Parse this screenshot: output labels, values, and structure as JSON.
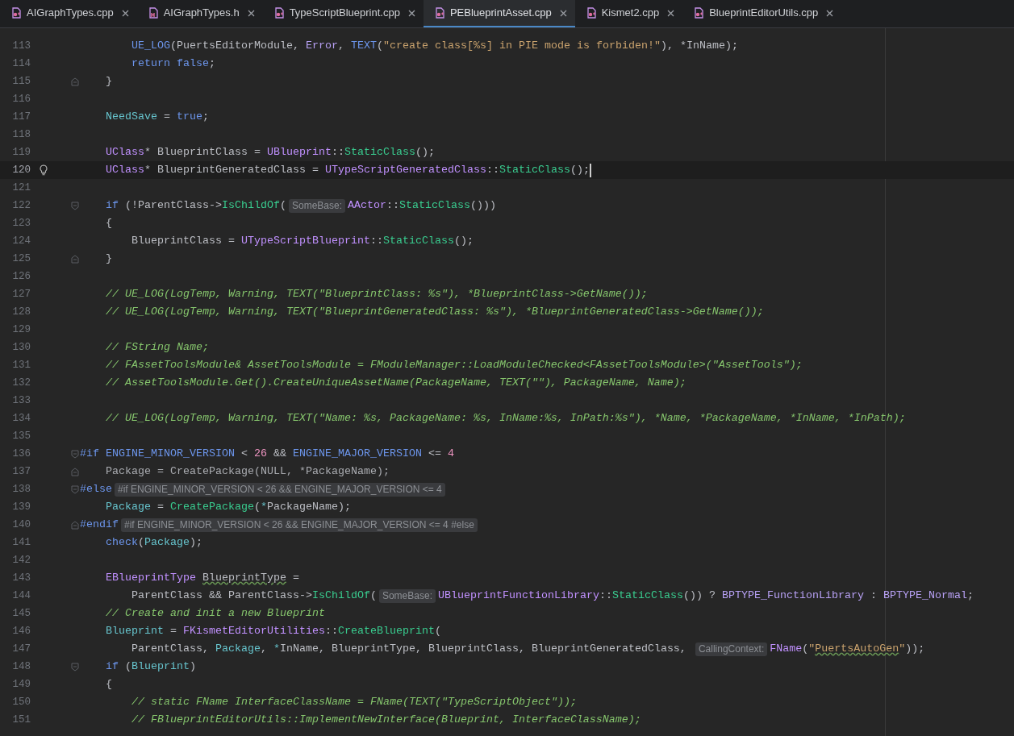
{
  "tabs": [
    {
      "label": "AIGraphTypes.cpp",
      "kind": "cpp",
      "selected": false
    },
    {
      "label": "AIGraphTypes.h",
      "kind": "h",
      "selected": false
    },
    {
      "label": "TypeScriptBlueprint.cpp",
      "kind": "cpp",
      "selected": false
    },
    {
      "label": "PEBlueprintAsset.cpp",
      "kind": "cpp",
      "selected": true
    },
    {
      "label": "Kismet2.cpp",
      "kind": "cpp",
      "selected": false
    },
    {
      "label": "BlueprintEditorUtils.cpp",
      "kind": "cpp",
      "selected": false
    }
  ],
  "lines": [
    {
      "n": "113",
      "tokens": [
        {
          "kind": "macro",
          "text": "        UE_LOG"
        },
        {
          "kind": "plain",
          "text": "(PuertsEditorModule, "
        },
        {
          "kind": "enum",
          "text": "Error"
        },
        {
          "kind": "plain",
          "text": ", "
        },
        {
          "kind": "macro",
          "text": "TEXT"
        },
        {
          "kind": "plain",
          "text": "("
        },
        {
          "kind": "string",
          "text": "\"create class[%s] in PIE mode is forbiden!\""
        },
        {
          "kind": "plain",
          "text": "), *InName);"
        }
      ]
    },
    {
      "n": "114",
      "tokens": [
        {
          "kind": "keyword",
          "text": "        return false"
        },
        {
          "kind": "plain",
          "text": ";"
        }
      ]
    },
    {
      "n": "115",
      "fold_end": true,
      "tokens": [
        {
          "kind": "plain",
          "text": "    }"
        }
      ]
    },
    {
      "n": "116"
    },
    {
      "n": "117",
      "tokens": [
        {
          "kind": "variable",
          "text": "    NeedSave"
        },
        {
          "kind": "plain",
          "text": " = "
        },
        {
          "kind": "keyword",
          "text": "true"
        },
        {
          "kind": "plain",
          "text": ";"
        }
      ]
    },
    {
      "n": "118"
    },
    {
      "n": "119",
      "tokens": [
        {
          "kind": "type",
          "text": "    UClass"
        },
        {
          "kind": "plain",
          "text": "* BlueprintClass = "
        },
        {
          "kind": "type",
          "text": "UBlueprint"
        },
        {
          "kind": "plain",
          "text": "::"
        },
        {
          "kind": "function",
          "text": "StaticClass"
        },
        {
          "kind": "plain",
          "text": "();"
        }
      ]
    },
    {
      "n": "120",
      "current": true,
      "bulb": true,
      "tokens": [
        {
          "kind": "type",
          "text": "    UClass"
        },
        {
          "kind": "plain",
          "text": "* BlueprintGeneratedClass = "
        },
        {
          "kind": "type",
          "text": "UTypeScriptGeneratedClass"
        },
        {
          "kind": "plain",
          "text": "::"
        },
        {
          "kind": "function",
          "text": "StaticClass"
        },
        {
          "kind": "plain",
          "text": "();"
        }
      ]
    },
    {
      "n": "121"
    },
    {
      "n": "122",
      "fold_start": true,
      "tokens": [
        {
          "kind": "keyword",
          "text": "    if"
        },
        {
          "kind": "plain",
          "text": " (!ParentClass->"
        },
        {
          "kind": "function",
          "text": "IsChildOf"
        },
        {
          "kind": "plain",
          "text": "("
        },
        {
          "kind": "hint",
          "text": "SomeBase:"
        },
        {
          "kind": "type",
          "text": "AActor"
        },
        {
          "kind": "plain",
          "text": "::"
        },
        {
          "kind": "function",
          "text": "StaticClass"
        },
        {
          "kind": "plain",
          "text": "()))"
        }
      ]
    },
    {
      "n": "123",
      "tokens": [
        {
          "kind": "plain",
          "text": "    {"
        }
      ]
    },
    {
      "n": "124",
      "tokens": [
        {
          "kind": "plain",
          "text": "        BlueprintClass = "
        },
        {
          "kind": "type",
          "text": "UTypeScriptBlueprint"
        },
        {
          "kind": "plain",
          "text": "::"
        },
        {
          "kind": "function",
          "text": "StaticClass"
        },
        {
          "kind": "plain",
          "text": "();"
        }
      ]
    },
    {
      "n": "125",
      "fold_end": true,
      "tokens": [
        {
          "kind": "plain",
          "text": "    }"
        }
      ]
    },
    {
      "n": "126"
    },
    {
      "n": "127",
      "tokens": [
        {
          "kind": "comment",
          "text": "    // UE_LOG(LogTemp, Warning, TEXT(\"BlueprintClass: %s\"), *BlueprintClass->GetName());"
        }
      ]
    },
    {
      "n": "128",
      "tokens": [
        {
          "kind": "comment",
          "text": "    // UE_LOG(LogTemp, Warning, TEXT(\"BlueprintGeneratedClass: %s\"), *BlueprintGeneratedClass->GetName());"
        }
      ]
    },
    {
      "n": "129"
    },
    {
      "n": "130",
      "tokens": [
        {
          "kind": "comment",
          "text": "    // FString Name;"
        }
      ]
    },
    {
      "n": "131",
      "tokens": [
        {
          "kind": "comment",
          "text": "    // FAssetToolsModule& AssetToolsModule = FModuleManager::LoadModuleChecked<FAssetToolsModule>(\"AssetTools\");"
        }
      ]
    },
    {
      "n": "132",
      "tokens": [
        {
          "kind": "comment",
          "text": "    // AssetToolsModule.Get().CreateUniqueAssetName(PackageName, TEXT(\"\"), PackageName, Name);"
        }
      ]
    },
    {
      "n": "133"
    },
    {
      "n": "134",
      "tokens": [
        {
          "kind": "comment",
          "text": "    // UE_LOG(LogTemp, Warning, TEXT(\"Name: %s, PackageName: %s, InName:%s, InPath:%s\"), *Name, *PackageName, *InName, *InPath);"
        }
      ]
    },
    {
      "n": "135"
    },
    {
      "n": "136",
      "fold_start": true,
      "tokens": [
        {
          "kind": "directive",
          "text": "#if "
        },
        {
          "kind": "macro",
          "text": "ENGINE_MINOR_VERSION"
        },
        {
          "kind": "plain",
          "text": " < "
        },
        {
          "kind": "number",
          "text": "26"
        },
        {
          "kind": "plain",
          "text": " && "
        },
        {
          "kind": "macro",
          "text": "ENGINE_MAJOR_VERSION"
        },
        {
          "kind": "plain",
          "text": " <= "
        },
        {
          "kind": "number",
          "text": "4"
        }
      ]
    },
    {
      "n": "137",
      "fold_end": true,
      "tokens": [
        {
          "kind": "inactive",
          "text": "    Package = CreatePackage(NULL, *PackageName);"
        }
      ]
    },
    {
      "n": "138",
      "fold_start": true,
      "tokens": [
        {
          "kind": "directive",
          "text": "#else"
        },
        {
          "kind": "hint",
          "text": "#if ENGINE_MINOR_VERSION < 26 && ENGINE_MAJOR_VERSION <= 4"
        }
      ]
    },
    {
      "n": "139",
      "tokens": [
        {
          "kind": "variable",
          "text": "    Package"
        },
        {
          "kind": "plain",
          "text": " = "
        },
        {
          "kind": "function",
          "text": "CreatePackage"
        },
        {
          "kind": "plain",
          "text": "("
        },
        {
          "kind": "variable",
          "text": "*"
        },
        {
          "kind": "plain",
          "text": "PackageName);"
        }
      ]
    },
    {
      "n": "140",
      "fold_end": true,
      "tokens": [
        {
          "kind": "directive",
          "text": "#endif"
        },
        {
          "kind": "hint",
          "text": "#if ENGINE_MINOR_VERSION < 26 && ENGINE_MAJOR_VERSION <= 4 #else"
        }
      ]
    },
    {
      "n": "141",
      "tokens": [
        {
          "kind": "macro",
          "text": "    check"
        },
        {
          "kind": "plain",
          "text": "("
        },
        {
          "kind": "variable",
          "text": "Package"
        },
        {
          "kind": "plain",
          "text": ");"
        }
      ]
    },
    {
      "n": "142"
    },
    {
      "n": "143",
      "tokens": [
        {
          "kind": "type",
          "text": "    EBlueprintType "
        },
        {
          "kind": "typo",
          "text": "BlueprintType"
        },
        {
          "kind": "plain",
          "text": " ="
        }
      ]
    },
    {
      "n": "144",
      "tokens": [
        {
          "kind": "plain",
          "text": "        ParentClass && ParentClass->"
        },
        {
          "kind": "function",
          "text": "IsChildOf"
        },
        {
          "kind": "plain",
          "text": "("
        },
        {
          "kind": "hint",
          "text": "SomeBase:"
        },
        {
          "kind": "type",
          "text": "UBlueprintFunctionLibrary"
        },
        {
          "kind": "plain",
          "text": "::"
        },
        {
          "kind": "function",
          "text": "StaticClass"
        },
        {
          "kind": "plain",
          "text": "()) ? "
        },
        {
          "kind": "enum",
          "text": "BPTYPE_FunctionLibrary"
        },
        {
          "kind": "plain",
          "text": " : "
        },
        {
          "kind": "enum",
          "text": "BPTYPE_Normal"
        },
        {
          "kind": "plain",
          "text": ";"
        }
      ]
    },
    {
      "n": "145",
      "tokens": [
        {
          "kind": "comment",
          "text": "    // Create and init a new Blueprint"
        }
      ]
    },
    {
      "n": "146",
      "tokens": [
        {
          "kind": "variable",
          "text": "    Blueprint"
        },
        {
          "kind": "plain",
          "text": " = "
        },
        {
          "kind": "type",
          "text": "FKismetEditorUtilities"
        },
        {
          "kind": "plain",
          "text": "::"
        },
        {
          "kind": "function",
          "text": "CreateBlueprint"
        },
        {
          "kind": "plain",
          "text": "("
        }
      ]
    },
    {
      "n": "147",
      "tokens": [
        {
          "kind": "plain",
          "text": "        ParentClass, "
        },
        {
          "kind": "variable",
          "text": "Package"
        },
        {
          "kind": "plain",
          "text": ", "
        },
        {
          "kind": "variable",
          "text": "*"
        },
        {
          "kind": "plain",
          "text": "InName, BlueprintType, BlueprintClass, BlueprintGeneratedClass, "
        },
        {
          "kind": "hint",
          "text": "CallingContext:"
        },
        {
          "kind": "type",
          "text": "FName"
        },
        {
          "kind": "plain",
          "text": "("
        },
        {
          "kind": "string",
          "text": "\""
        },
        {
          "kind": "string_typo",
          "text": "PuertsAutoGen"
        },
        {
          "kind": "string",
          "text": "\""
        },
        {
          "kind": "plain",
          "text": "));"
        }
      ]
    },
    {
      "n": "148",
      "fold_start": true,
      "tokens": [
        {
          "kind": "keyword",
          "text": "    if"
        },
        {
          "kind": "plain",
          "text": " ("
        },
        {
          "kind": "variable",
          "text": "Blueprint"
        },
        {
          "kind": "plain",
          "text": ")"
        }
      ]
    },
    {
      "n": "149",
      "tokens": [
        {
          "kind": "plain",
          "text": "    {"
        }
      ]
    },
    {
      "n": "150",
      "tokens": [
        {
          "kind": "comment",
          "text": "        // static FName InterfaceClassName = FName(TEXT(\"TypeScriptObject\"));"
        }
      ]
    },
    {
      "n": "151",
      "tokens": [
        {
          "kind": "comment",
          "text": "        // FBlueprintEditorUtils::ImplementNewInterface(Blueprint, InterfaceClassName);"
        }
      ]
    }
  ]
}
